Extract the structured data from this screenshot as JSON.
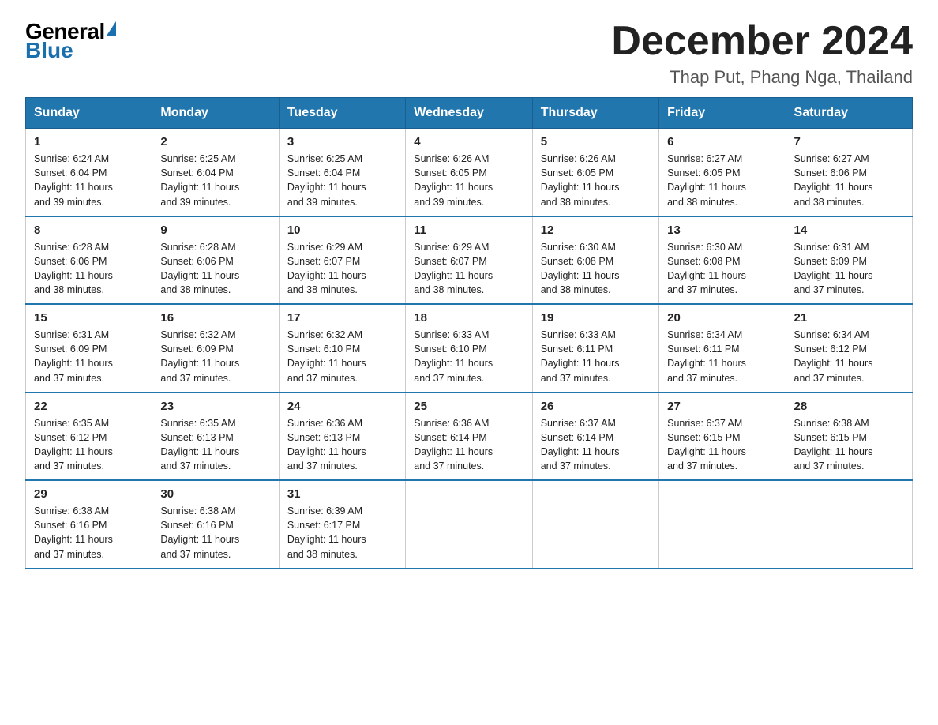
{
  "logo": {
    "general": "General",
    "blue": "Blue"
  },
  "header": {
    "month": "December 2024",
    "location": "Thap Put, Phang Nga, Thailand"
  },
  "weekdays": [
    "Sunday",
    "Monday",
    "Tuesday",
    "Wednesday",
    "Thursday",
    "Friday",
    "Saturday"
  ],
  "weeks": [
    [
      {
        "day": "1",
        "sunrise": "6:24 AM",
        "sunset": "6:04 PM",
        "daylight": "11 hours and 39 minutes."
      },
      {
        "day": "2",
        "sunrise": "6:25 AM",
        "sunset": "6:04 PM",
        "daylight": "11 hours and 39 minutes."
      },
      {
        "day": "3",
        "sunrise": "6:25 AM",
        "sunset": "6:04 PM",
        "daylight": "11 hours and 39 minutes."
      },
      {
        "day": "4",
        "sunrise": "6:26 AM",
        "sunset": "6:05 PM",
        "daylight": "11 hours and 39 minutes."
      },
      {
        "day": "5",
        "sunrise": "6:26 AM",
        "sunset": "6:05 PM",
        "daylight": "11 hours and 38 minutes."
      },
      {
        "day": "6",
        "sunrise": "6:27 AM",
        "sunset": "6:05 PM",
        "daylight": "11 hours and 38 minutes."
      },
      {
        "day": "7",
        "sunrise": "6:27 AM",
        "sunset": "6:06 PM",
        "daylight": "11 hours and 38 minutes."
      }
    ],
    [
      {
        "day": "8",
        "sunrise": "6:28 AM",
        "sunset": "6:06 PM",
        "daylight": "11 hours and 38 minutes."
      },
      {
        "day": "9",
        "sunrise": "6:28 AM",
        "sunset": "6:06 PM",
        "daylight": "11 hours and 38 minutes."
      },
      {
        "day": "10",
        "sunrise": "6:29 AM",
        "sunset": "6:07 PM",
        "daylight": "11 hours and 38 minutes."
      },
      {
        "day": "11",
        "sunrise": "6:29 AM",
        "sunset": "6:07 PM",
        "daylight": "11 hours and 38 minutes."
      },
      {
        "day": "12",
        "sunrise": "6:30 AM",
        "sunset": "6:08 PM",
        "daylight": "11 hours and 38 minutes."
      },
      {
        "day": "13",
        "sunrise": "6:30 AM",
        "sunset": "6:08 PM",
        "daylight": "11 hours and 37 minutes."
      },
      {
        "day": "14",
        "sunrise": "6:31 AM",
        "sunset": "6:09 PM",
        "daylight": "11 hours and 37 minutes."
      }
    ],
    [
      {
        "day": "15",
        "sunrise": "6:31 AM",
        "sunset": "6:09 PM",
        "daylight": "11 hours and 37 minutes."
      },
      {
        "day": "16",
        "sunrise": "6:32 AM",
        "sunset": "6:09 PM",
        "daylight": "11 hours and 37 minutes."
      },
      {
        "day": "17",
        "sunrise": "6:32 AM",
        "sunset": "6:10 PM",
        "daylight": "11 hours and 37 minutes."
      },
      {
        "day": "18",
        "sunrise": "6:33 AM",
        "sunset": "6:10 PM",
        "daylight": "11 hours and 37 minutes."
      },
      {
        "day": "19",
        "sunrise": "6:33 AM",
        "sunset": "6:11 PM",
        "daylight": "11 hours and 37 minutes."
      },
      {
        "day": "20",
        "sunrise": "6:34 AM",
        "sunset": "6:11 PM",
        "daylight": "11 hours and 37 minutes."
      },
      {
        "day": "21",
        "sunrise": "6:34 AM",
        "sunset": "6:12 PM",
        "daylight": "11 hours and 37 minutes."
      }
    ],
    [
      {
        "day": "22",
        "sunrise": "6:35 AM",
        "sunset": "6:12 PM",
        "daylight": "11 hours and 37 minutes."
      },
      {
        "day": "23",
        "sunrise": "6:35 AM",
        "sunset": "6:13 PM",
        "daylight": "11 hours and 37 minutes."
      },
      {
        "day": "24",
        "sunrise": "6:36 AM",
        "sunset": "6:13 PM",
        "daylight": "11 hours and 37 minutes."
      },
      {
        "day": "25",
        "sunrise": "6:36 AM",
        "sunset": "6:14 PM",
        "daylight": "11 hours and 37 minutes."
      },
      {
        "day": "26",
        "sunrise": "6:37 AM",
        "sunset": "6:14 PM",
        "daylight": "11 hours and 37 minutes."
      },
      {
        "day": "27",
        "sunrise": "6:37 AM",
        "sunset": "6:15 PM",
        "daylight": "11 hours and 37 minutes."
      },
      {
        "day": "28",
        "sunrise": "6:38 AM",
        "sunset": "6:15 PM",
        "daylight": "11 hours and 37 minutes."
      }
    ],
    [
      {
        "day": "29",
        "sunrise": "6:38 AM",
        "sunset": "6:16 PM",
        "daylight": "11 hours and 37 minutes."
      },
      {
        "day": "30",
        "sunrise": "6:38 AM",
        "sunset": "6:16 PM",
        "daylight": "11 hours and 37 minutes."
      },
      {
        "day": "31",
        "sunrise": "6:39 AM",
        "sunset": "6:17 PM",
        "daylight": "11 hours and 38 minutes."
      },
      null,
      null,
      null,
      null
    ]
  ],
  "labels": {
    "sunrise": "Sunrise:",
    "sunset": "Sunset:",
    "daylight": "Daylight:"
  }
}
